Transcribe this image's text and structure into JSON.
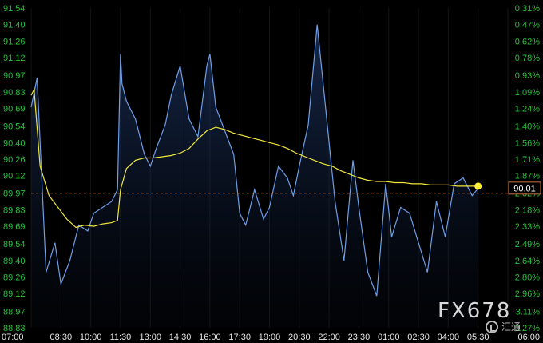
{
  "chart_data": {
    "type": "line",
    "instrument_price_label": "90.01",
    "reference_price": 89.97,
    "y_ticks": [
      "91.54",
      "91.40",
      "91.26",
      "91.12",
      "90.97",
      "90.83",
      "90.69",
      "90.54",
      "90.40",
      "90.26",
      "90.12",
      "89.97",
      "89.83",
      "89.69",
      "89.54",
      "89.40",
      "89.26",
      "89.12",
      "88.97",
      "88.83"
    ],
    "y_values": [
      91.54,
      91.4,
      91.26,
      91.12,
      90.97,
      90.83,
      90.69,
      90.54,
      90.4,
      90.26,
      90.12,
      89.97,
      89.83,
      89.69,
      89.54,
      89.4,
      89.26,
      89.12,
      88.97,
      88.83
    ],
    "pct_ticks": [
      "0.31%",
      "0.47%",
      "0.62%",
      "0.78%",
      "0.93%",
      "1.09%",
      "1.24%",
      "1.40%",
      "1.56%",
      "1.71%",
      "1.87%",
      "2.02%",
      "2.18%",
      "2.33%",
      "2.49%",
      "2.64%",
      "2.80%",
      "2.96%",
      "3.11%",
      "3.27%"
    ],
    "x_ticks": [
      "07:00",
      "08:30",
      "10:00",
      "11:30",
      "13:00",
      "14:30",
      "16:00",
      "17:30",
      "19:00",
      "20:30",
      "22:00",
      "23:30",
      "01:00",
      "02:30",
      "04:00",
      "05:30",
      "06:00"
    ],
    "x_tick_indices": [
      0,
      1,
      2,
      3,
      4,
      5,
      6,
      7,
      8,
      9,
      10,
      11,
      12,
      13,
      14,
      15,
      16
    ],
    "series": [
      {
        "role": "price",
        "color": "#6d9ee8",
        "x": [
          0,
          0.2,
          0.5,
          0.8,
          1.0,
          1.3,
          1.6,
          1.9,
          2.1,
          2.4,
          2.7,
          2.9,
          3.0,
          3.05,
          3.2,
          3.5,
          3.8,
          4.0,
          4.2,
          4.5,
          4.7,
          5.0,
          5.3,
          5.6,
          5.9,
          6.0,
          6.2,
          6.5,
          6.8,
          7.0,
          7.2,
          7.5,
          7.8,
          8.0,
          8.3,
          8.6,
          8.8,
          9.0,
          9.3,
          9.6,
          9.8,
          10.0,
          10.2,
          10.5,
          10.8,
          11.0,
          11.3,
          11.6,
          11.9,
          12.1,
          12.4,
          12.7,
          13.0,
          13.3,
          13.6,
          13.9,
          14.2,
          14.5,
          14.8,
          15.0
        ],
        "y": [
          90.7,
          90.95,
          89.3,
          89.55,
          89.2,
          89.4,
          89.7,
          89.65,
          89.8,
          89.85,
          89.9,
          90.0,
          91.15,
          90.9,
          90.75,
          90.6,
          90.3,
          90.2,
          90.35,
          90.55,
          90.8,
          91.05,
          90.6,
          90.45,
          91.05,
          91.15,
          90.7,
          90.5,
          90.3,
          89.8,
          89.7,
          90.0,
          89.75,
          89.85,
          90.2,
          90.1,
          89.95,
          90.2,
          90.55,
          91.4,
          90.9,
          90.4,
          89.9,
          89.4,
          90.25,
          89.85,
          89.3,
          89.1,
          90.05,
          89.6,
          89.85,
          89.8,
          89.55,
          89.3,
          89.9,
          89.6,
          90.05,
          90.1,
          89.95,
          90.01
        ]
      },
      {
        "role": "average",
        "color": "#f0e63c",
        "x": [
          0,
          0.1,
          0.3,
          0.6,
          0.9,
          1.2,
          1.5,
          1.8,
          2.1,
          2.4,
          2.7,
          2.9,
          3.0,
          3.2,
          3.5,
          3.8,
          4.1,
          4.4,
          4.7,
          5.0,
          5.3,
          5.6,
          5.9,
          6.2,
          6.5,
          6.8,
          7.1,
          7.4,
          7.7,
          8.0,
          8.3,
          8.6,
          8.9,
          9.2,
          9.5,
          9.8,
          10.1,
          10.4,
          10.7,
          11.0,
          11.3,
          11.6,
          11.9,
          12.2,
          12.5,
          12.8,
          13.1,
          13.4,
          13.7,
          14.0,
          14.3,
          14.6,
          15.0
        ],
        "y": [
          90.8,
          90.85,
          90.2,
          89.95,
          89.85,
          89.75,
          89.68,
          89.7,
          89.69,
          89.71,
          89.72,
          89.74,
          90.0,
          90.18,
          90.25,
          90.27,
          90.27,
          90.28,
          90.29,
          90.31,
          90.35,
          90.43,
          90.5,
          90.53,
          90.51,
          90.48,
          90.46,
          90.44,
          90.42,
          90.4,
          90.38,
          90.35,
          90.31,
          90.28,
          90.25,
          90.22,
          90.2,
          90.16,
          90.13,
          90.1,
          90.08,
          90.07,
          90.07,
          90.06,
          90.06,
          90.05,
          90.05,
          90.04,
          90.04,
          90.04,
          90.03,
          90.03,
          90.03
        ]
      }
    ]
  },
  "watermark": {
    "brand": "FX678",
    "sub": "汇通"
  }
}
